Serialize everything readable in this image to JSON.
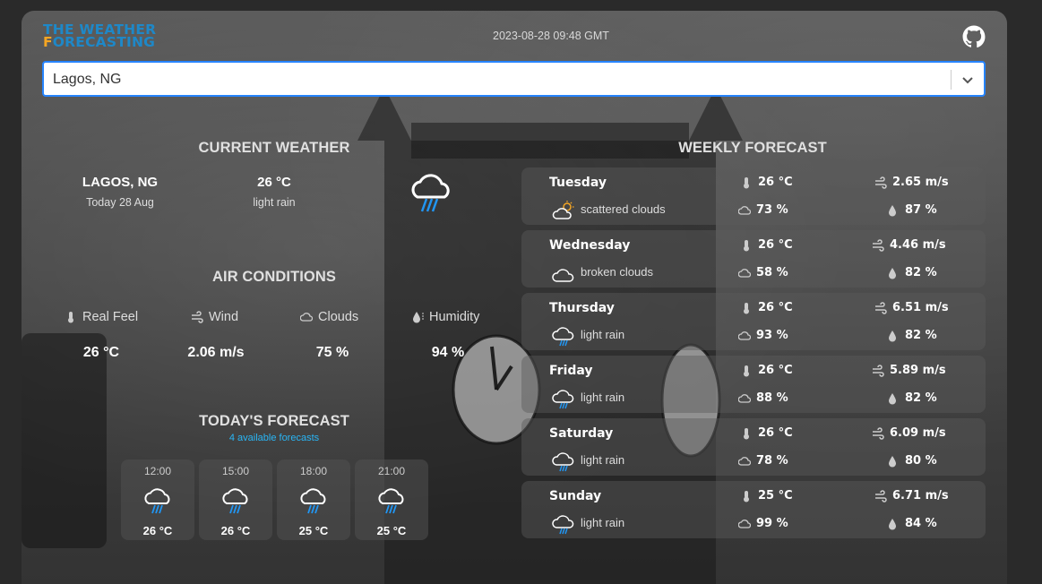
{
  "app": {
    "logo_line1": "The Weather",
    "logo_line2_accent": "F",
    "logo_line2_rest": "orecasting",
    "datetime": "2023-08-28 09:48 GMT",
    "search_value": "Lagos, NG"
  },
  "current": {
    "title": "CURRENT WEATHER",
    "city": "LAGOS, NG",
    "date": "Today 28 Aug",
    "temp": "26 °C",
    "desc": "light rain",
    "icon": "rain-cloud-icon"
  },
  "air": {
    "title": "AIR CONDITIONS",
    "real_feel_label": "Real Feel",
    "wind_label": "Wind",
    "clouds_label": "Clouds",
    "humidity_label": "Humidity",
    "real_feel": "26 °C",
    "wind": "2.06 m/s",
    "clouds": "75 %",
    "humidity": "94 %"
  },
  "today": {
    "title": "TODAY'S FORECAST",
    "subtitle": "4 available forecasts",
    "items": [
      {
        "time": "12:00",
        "temp": "26 °C",
        "icon": "rain-cloud-icon"
      },
      {
        "time": "15:00",
        "temp": "26 °C",
        "icon": "rain-cloud-icon"
      },
      {
        "time": "18:00",
        "temp": "25 °C",
        "icon": "rain-cloud-icon"
      },
      {
        "time": "21:00",
        "temp": "25 °C",
        "icon": "rain-cloud-icon"
      }
    ]
  },
  "weekly": {
    "title": "WEEKLY FORECAST",
    "days": [
      {
        "day": "Tuesday",
        "desc": "scattered clouds",
        "icon": "sun-cloud-icon",
        "temp": "26 °C",
        "wind": "2.65 m/s",
        "clouds": "73 %",
        "humidity": "87 %"
      },
      {
        "day": "Wednesday",
        "desc": "broken clouds",
        "icon": "cloud-icon",
        "temp": "26 °C",
        "wind": "4.46 m/s",
        "clouds": "58 %",
        "humidity": "82 %"
      },
      {
        "day": "Thursday",
        "desc": "light rain",
        "icon": "rain-cloud-icon",
        "temp": "26 °C",
        "wind": "6.51 m/s",
        "clouds": "93 %",
        "humidity": "82 %"
      },
      {
        "day": "Friday",
        "desc": "light rain",
        "icon": "rain-cloud-icon",
        "temp": "26 °C",
        "wind": "5.89 m/s",
        "clouds": "88 %",
        "humidity": "82 %"
      },
      {
        "day": "Saturday",
        "desc": "light rain",
        "icon": "rain-cloud-icon",
        "temp": "26 °C",
        "wind": "6.09 m/s",
        "clouds": "78 %",
        "humidity": "80 %"
      },
      {
        "day": "Sunday",
        "desc": "light rain",
        "icon": "rain-cloud-icon",
        "temp": "25 °C",
        "wind": "6.71 m/s",
        "clouds": "99 %",
        "humidity": "84 %"
      }
    ]
  },
  "colors": {
    "accent": "#1e88c8",
    "logo_accent": "#f5a623",
    "rain": "#2196f3",
    "subtitle": "#29b6f6"
  }
}
